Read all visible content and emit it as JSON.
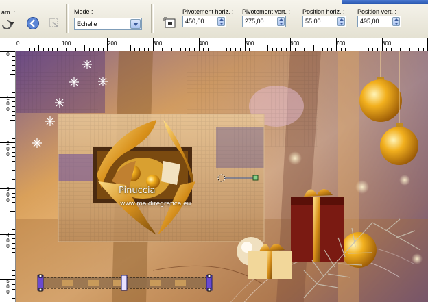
{
  "toolbar": {
    "param_label": "am. :",
    "mode_label": "Mode :",
    "mode_value": "Échelle",
    "pivot_h_label": "Pivotement horiz. :",
    "pivot_h_value": "450,00",
    "pivot_v_label": "Pivotement vert. :",
    "pivot_v_value": "275,00",
    "pos_h_label": "Position horiz. :",
    "pos_h_value": "55,00",
    "pos_v_label": "Position vert. :",
    "pos_v_value": "495,00"
  },
  "ruler": {
    "h_labels": [
      "0",
      "100",
      "200",
      "300",
      "400",
      "500",
      "600",
      "700",
      "800"
    ],
    "v_labels": [
      "0",
      "100",
      "200",
      "300",
      "400",
      "500"
    ]
  },
  "canvas": {
    "watermark": "Pinuccia",
    "watermark_url": "www.maidiregrafica.eu"
  },
  "icons": [
    "rotate-icon",
    "dropdown-arrow-icon",
    "back-icon",
    "pick-tool-icon",
    "scale-icon",
    "snowflake-icon",
    "ornament-icon",
    "gift-icon",
    "handle-icon"
  ]
}
